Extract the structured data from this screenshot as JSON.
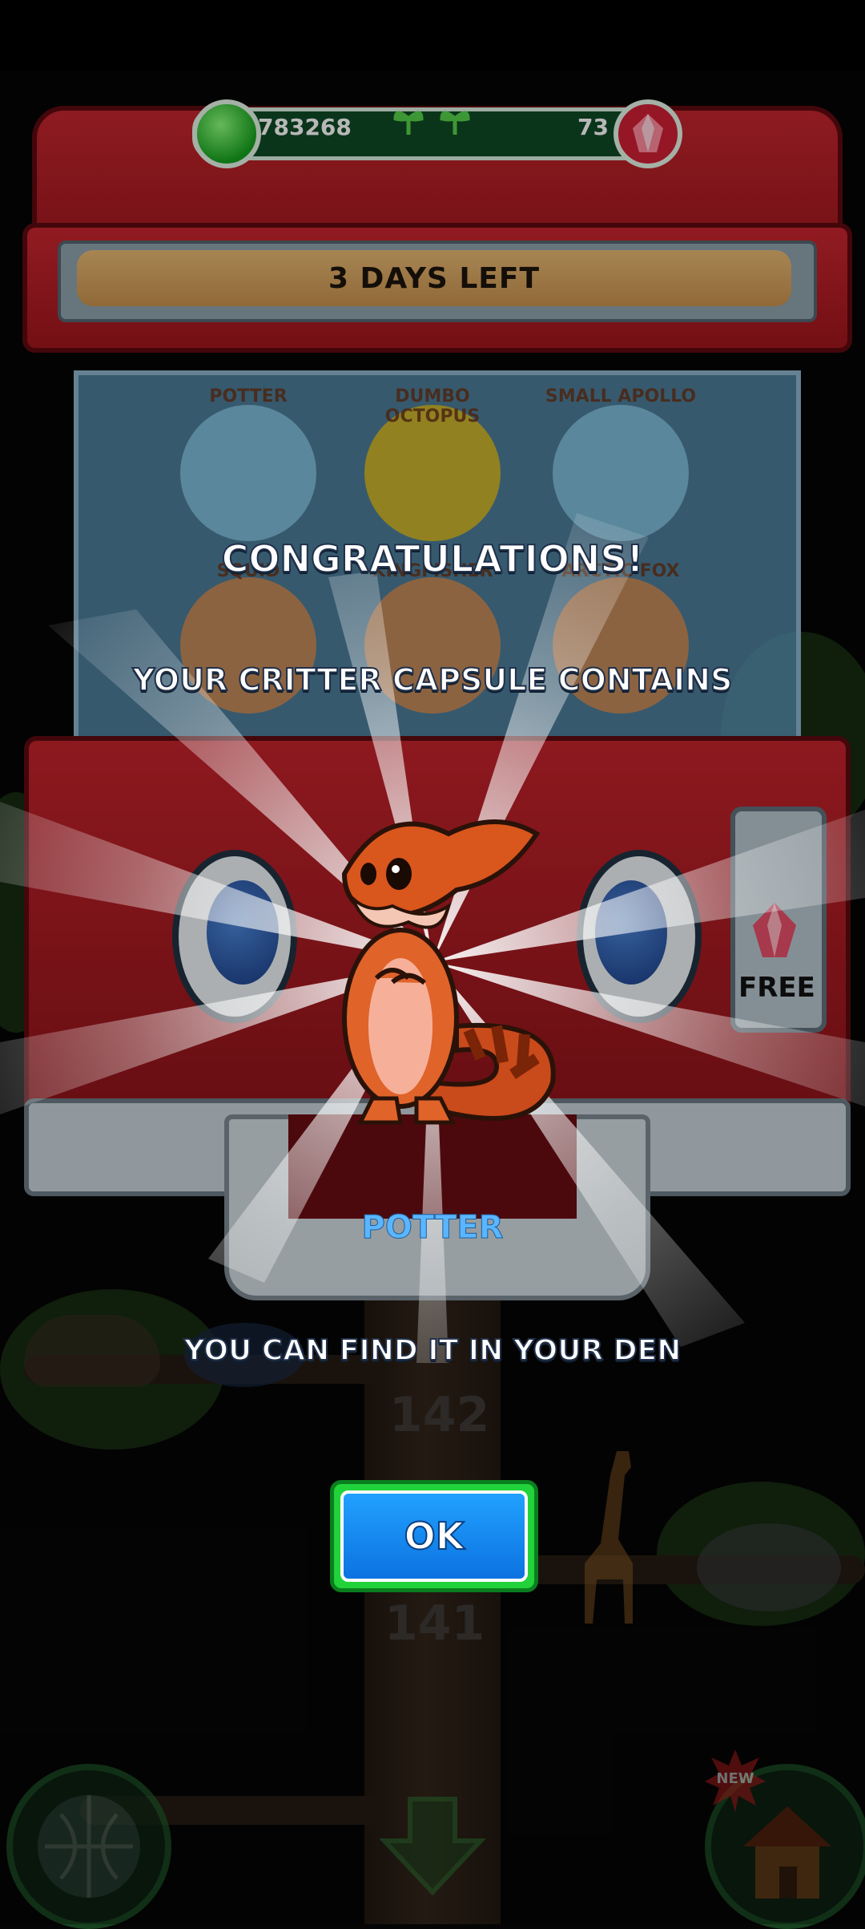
{
  "currency": {
    "green_gems": "783268",
    "red_gems": "73"
  },
  "banner": {
    "text": "3 DAYS LEFT"
  },
  "capsule_items": [
    {
      "label": "POTTER"
    },
    {
      "label": "DUMBO OCTOPUS"
    },
    {
      "label": "SMALL APOLLO"
    },
    {
      "label": "SQUID"
    },
    {
      "label": "KINGFISHER"
    },
    {
      "label": "ARCTIC FOX"
    }
  ],
  "dialog": {
    "title": "CONGRATULATIONS!",
    "subtitle": "YOUR CRITTER CAPSULE CONTAINS",
    "critter_name": "POTTER",
    "message": "YOU CAN FIND IT IN YOUR DEN",
    "ok_label": "OK"
  },
  "machine": {
    "free_label": "FREE"
  },
  "background": {
    "level_numbers": [
      "142",
      "141"
    ],
    "new_badge": "NEW"
  },
  "colors": {
    "machine_red": "#b81f27",
    "ok_blue": "#1a8cf2",
    "ok_green_border": "#22d23a",
    "critter_name_color": "#5ab6ff"
  }
}
